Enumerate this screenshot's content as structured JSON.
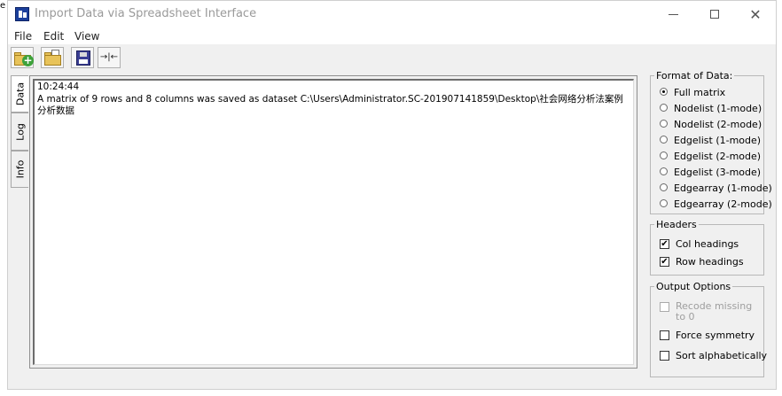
{
  "corner_text": "e",
  "window": {
    "title": "Import Data via Spreadsheet Interface",
    "close_glyph": "✕"
  },
  "menu": {
    "file": "File",
    "edit": "Edit",
    "view": "View"
  },
  "toolbar": {
    "new_icon": "folder-new-icon",
    "open_icon": "folder-open-icon",
    "save_icon": "save-disk-icon",
    "fit_icon": "fit-arrows-icon",
    "fit_glyph": "→|←"
  },
  "tabs": {
    "data": "Data",
    "log": "Log",
    "info": "Info"
  },
  "log": {
    "time": "10:24:44",
    "message": "A matrix of 9 rows and 8 columns was saved as dataset C:\\Users\\Administrator.SC-201907141859\\Desktop\\社会网络分析法案例分析数据"
  },
  "format": {
    "title": "Format of Data:",
    "options": [
      "Full matrix",
      "Nodelist (1-mode)",
      "Nodelist (2-mode)",
      "Edgelist (1-mode)",
      "Edgelist (2-mode)",
      "Edgelist (3-mode)",
      "Edgearray (1-mode)",
      "Edgearray (2-mode)"
    ],
    "selected": "Full matrix"
  },
  "headers": {
    "title": "Headers",
    "col": "Col headings",
    "row": "Row headings",
    "check_mark": "✔"
  },
  "output": {
    "title": "Output Options",
    "recode": "Recode missing to 0",
    "symmetry": "Force symmetry",
    "sort": "Sort alphabetically"
  }
}
